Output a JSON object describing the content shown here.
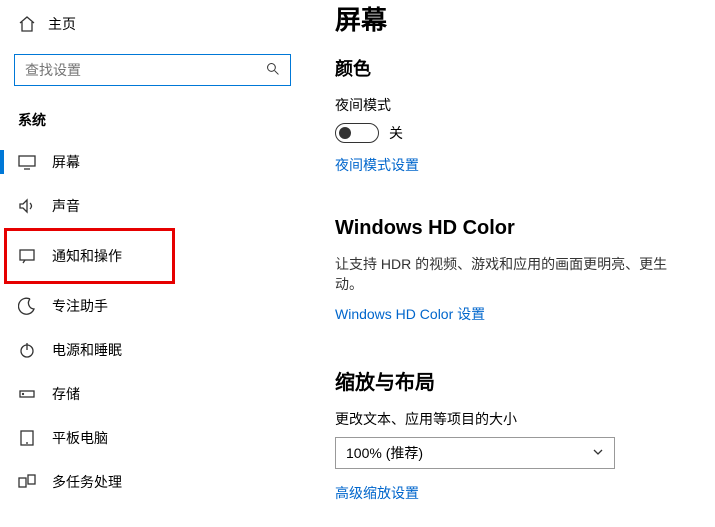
{
  "sidebar": {
    "home": "主页",
    "search_placeholder": "查找设置",
    "section": "系统",
    "items": [
      {
        "label": "屏幕"
      },
      {
        "label": "声音"
      },
      {
        "label": "通知和操作"
      },
      {
        "label": "专注助手"
      },
      {
        "label": "电源和睡眠"
      },
      {
        "label": "存储"
      },
      {
        "label": "平板电脑"
      },
      {
        "label": "多任务处理"
      }
    ]
  },
  "content": {
    "page_title": "屏幕",
    "color": {
      "heading": "颜色",
      "night_mode_label": "夜间模式",
      "toggle_state": "关",
      "night_mode_link": "夜间模式设置"
    },
    "hd": {
      "heading": "Windows HD Color",
      "desc": "让支持 HDR 的视频、游戏和应用的画面更明亮、更生动。",
      "link": "Windows HD Color 设置"
    },
    "scale": {
      "heading": "缩放与布局",
      "label": "更改文本、应用等项目的大小",
      "select_value": "100% (推荐)",
      "link": "高级缩放设置"
    }
  }
}
